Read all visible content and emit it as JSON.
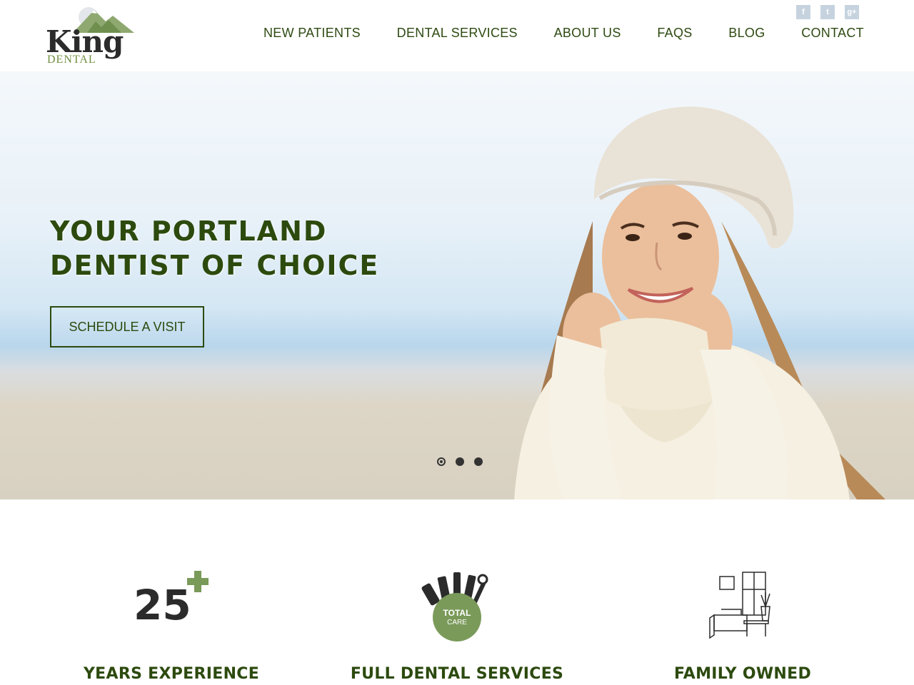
{
  "brand": {
    "name_main": "King",
    "name_sub": "DENTAL"
  },
  "social": [
    {
      "icon": "facebook-icon",
      "glyph": "f"
    },
    {
      "icon": "twitter-icon",
      "glyph": "t"
    },
    {
      "icon": "google-plus-icon",
      "glyph": "g+"
    }
  ],
  "nav": {
    "items": [
      "NEW PATIENTS",
      "DENTAL SERVICES",
      "ABOUT US",
      "FAQS",
      "BLOG",
      "CONTACT"
    ]
  },
  "hero": {
    "title_line1": "YOUR PORTLAND",
    "title_line2": "DENTIST OF CHOICE",
    "cta_label": "SCHEDULE A VISIT",
    "slide_count": 3,
    "active_slide": 1
  },
  "features": [
    {
      "label": "YEARS EXPERIENCE",
      "icon": "25-plus-icon",
      "icon_number": "25"
    },
    {
      "label": "FULL DENTAL SERVICES",
      "icon": "total-care-tools-icon",
      "icon_text_1": "TOTAL",
      "icon_text_2": "CARE"
    },
    {
      "label": "FAMILY OWNED",
      "icon": "living-room-sketch-icon"
    }
  ],
  "colors": {
    "brand_green": "#2c4a0e",
    "accent_green": "#7a9a5a",
    "social_bg": "#c6d3df"
  }
}
